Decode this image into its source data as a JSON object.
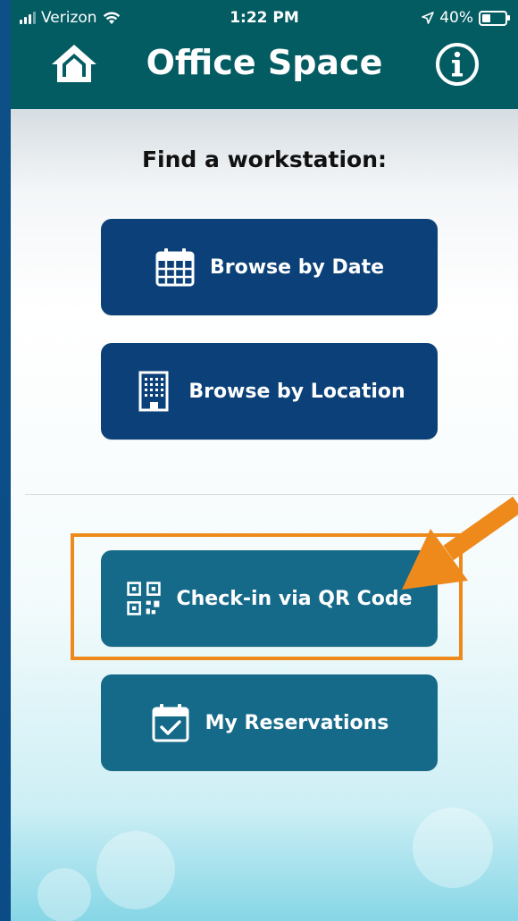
{
  "status_bar": {
    "carrier": "Verizon",
    "time": "1:22 PM",
    "battery": "40%"
  },
  "header": {
    "title": "Office Space"
  },
  "main": {
    "section_title": "Find a workstation:",
    "buttons": [
      {
        "label": "Browse by Date",
        "icon": "calendar-icon"
      },
      {
        "label": "Browse by Location",
        "icon": "building-icon"
      },
      {
        "label": "Check-in via QR Code",
        "icon": "qr-code-icon"
      },
      {
        "label": "My Reservations",
        "icon": "calendar-check-icon"
      }
    ]
  },
  "colors": {
    "header_bg": "#045c63",
    "primary_button": "#0b4178",
    "secondary_button": "#156a89",
    "highlight": "#ee8a1c"
  }
}
